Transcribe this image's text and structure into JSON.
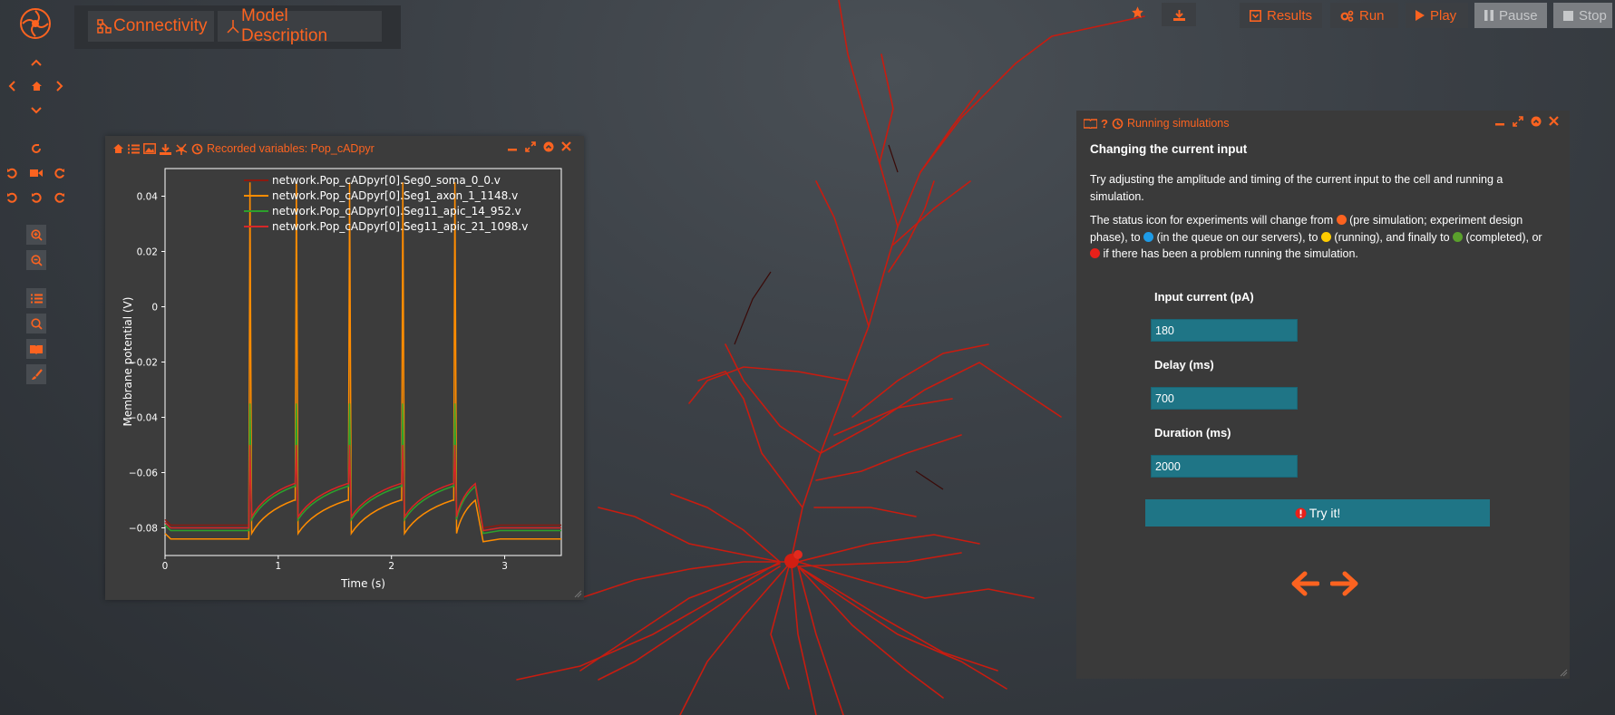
{
  "app": {
    "nav_tabs": [
      {
        "label": "Connectivity"
      },
      {
        "label": "Model Description"
      }
    ]
  },
  "toolbar": {
    "results": "Results",
    "run": "Run",
    "play": "Play",
    "pause": "Pause",
    "stop": "Stop"
  },
  "plot_panel": {
    "title": "Recorded variables: Pop_cADpyr"
  },
  "chart_data": {
    "type": "line",
    "xlabel": "Time (s)",
    "ylabel": "Membrane potential (V)",
    "xlim": [
      0,
      3.5
    ],
    "ylim": [
      -0.09,
      0.05
    ],
    "xticks": [
      "0",
      "1",
      "2",
      "3"
    ],
    "yticks": [
      "0.04",
      "0.02",
      "0",
      "−0.02",
      "−0.04",
      "−0.06",
      "−0.08"
    ],
    "spike_times": [
      0.75,
      1.16,
      1.63,
      2.1,
      2.56
    ],
    "series": [
      {
        "name": "network.Pop_cADpyr[0].Seg0_soma_0_0.v",
        "color": "#8b1a10",
        "rest": -0.079,
        "peak": -0.05,
        "trough": -0.068
      },
      {
        "name": "network.Pop_cADpyr[0].Seg1_axon_1_1148.v",
        "color": "#ff8c00",
        "rest": -0.084,
        "peak": 0.045,
        "trough": -0.074
      },
      {
        "name": "network.Pop_cADpyr[0].Seg11_apic_14_952.v",
        "color": "#2ca02c",
        "rest": -0.081,
        "peak": -0.035,
        "trough": -0.069
      },
      {
        "name": "network.Pop_cADpyr[0].Seg11_apic_21_1098.v",
        "color": "#d62728",
        "rest": -0.08,
        "peak": -0.05,
        "trough": -0.068
      }
    ]
  },
  "tutorial": {
    "title": "Running simulations",
    "heading": "Changing the current input",
    "para1": "Try adjusting the amplitude and timing of the current input to the cell and running a simulation.",
    "p2": {
      "a": "The status icon for experiments will change from",
      "b": "(pre simulation; experiment design phase), to",
      "c": "(in the queue on our servers), to",
      "d": "(running), and finally to",
      "e": "(completed), or",
      "f": "if there has been a problem running the simulation."
    },
    "status_colors": {
      "pre": "#fc6320",
      "queue": "#1e9be6",
      "running": "#ffcc00",
      "completed": "#5aa02c",
      "error": "#e8201a"
    },
    "fields": [
      {
        "label": "Input current (pA)",
        "value": "180"
      },
      {
        "label": "Delay (ms)",
        "value": "700"
      },
      {
        "label": "Duration (ms)",
        "value": "2000"
      }
    ],
    "try_label": "Try it!"
  },
  "colors": {
    "accent": "#fc6320",
    "panel": "#3c3c3c",
    "input": "#1f7586",
    "neuron": "#d21e12"
  }
}
